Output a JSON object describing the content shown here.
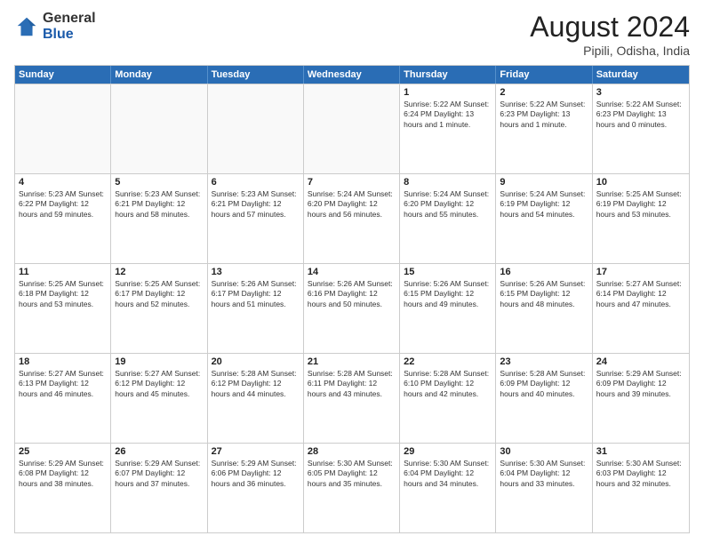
{
  "logo": {
    "general": "General",
    "blue": "Blue"
  },
  "title": "August 2024",
  "location": "Pipili, Odisha, India",
  "days_of_week": [
    "Sunday",
    "Monday",
    "Tuesday",
    "Wednesday",
    "Thursday",
    "Friday",
    "Saturday"
  ],
  "weeks": [
    [
      {
        "day": "",
        "info": "",
        "empty": true
      },
      {
        "day": "",
        "info": "",
        "empty": true
      },
      {
        "day": "",
        "info": "",
        "empty": true
      },
      {
        "day": "",
        "info": "",
        "empty": true
      },
      {
        "day": "1",
        "info": "Sunrise: 5:22 AM\nSunset: 6:24 PM\nDaylight: 13 hours\nand 1 minute.",
        "empty": false
      },
      {
        "day": "2",
        "info": "Sunrise: 5:22 AM\nSunset: 6:23 PM\nDaylight: 13 hours\nand 1 minute.",
        "empty": false
      },
      {
        "day": "3",
        "info": "Sunrise: 5:22 AM\nSunset: 6:23 PM\nDaylight: 13 hours\nand 0 minutes.",
        "empty": false
      }
    ],
    [
      {
        "day": "4",
        "info": "Sunrise: 5:23 AM\nSunset: 6:22 PM\nDaylight: 12 hours\nand 59 minutes.",
        "empty": false
      },
      {
        "day": "5",
        "info": "Sunrise: 5:23 AM\nSunset: 6:21 PM\nDaylight: 12 hours\nand 58 minutes.",
        "empty": false
      },
      {
        "day": "6",
        "info": "Sunrise: 5:23 AM\nSunset: 6:21 PM\nDaylight: 12 hours\nand 57 minutes.",
        "empty": false
      },
      {
        "day": "7",
        "info": "Sunrise: 5:24 AM\nSunset: 6:20 PM\nDaylight: 12 hours\nand 56 minutes.",
        "empty": false
      },
      {
        "day": "8",
        "info": "Sunrise: 5:24 AM\nSunset: 6:20 PM\nDaylight: 12 hours\nand 55 minutes.",
        "empty": false
      },
      {
        "day": "9",
        "info": "Sunrise: 5:24 AM\nSunset: 6:19 PM\nDaylight: 12 hours\nand 54 minutes.",
        "empty": false
      },
      {
        "day": "10",
        "info": "Sunrise: 5:25 AM\nSunset: 6:19 PM\nDaylight: 12 hours\nand 53 minutes.",
        "empty": false
      }
    ],
    [
      {
        "day": "11",
        "info": "Sunrise: 5:25 AM\nSunset: 6:18 PM\nDaylight: 12 hours\nand 53 minutes.",
        "empty": false
      },
      {
        "day": "12",
        "info": "Sunrise: 5:25 AM\nSunset: 6:17 PM\nDaylight: 12 hours\nand 52 minutes.",
        "empty": false
      },
      {
        "day": "13",
        "info": "Sunrise: 5:26 AM\nSunset: 6:17 PM\nDaylight: 12 hours\nand 51 minutes.",
        "empty": false
      },
      {
        "day": "14",
        "info": "Sunrise: 5:26 AM\nSunset: 6:16 PM\nDaylight: 12 hours\nand 50 minutes.",
        "empty": false
      },
      {
        "day": "15",
        "info": "Sunrise: 5:26 AM\nSunset: 6:15 PM\nDaylight: 12 hours\nand 49 minutes.",
        "empty": false
      },
      {
        "day": "16",
        "info": "Sunrise: 5:26 AM\nSunset: 6:15 PM\nDaylight: 12 hours\nand 48 minutes.",
        "empty": false
      },
      {
        "day": "17",
        "info": "Sunrise: 5:27 AM\nSunset: 6:14 PM\nDaylight: 12 hours\nand 47 minutes.",
        "empty": false
      }
    ],
    [
      {
        "day": "18",
        "info": "Sunrise: 5:27 AM\nSunset: 6:13 PM\nDaylight: 12 hours\nand 46 minutes.",
        "empty": false
      },
      {
        "day": "19",
        "info": "Sunrise: 5:27 AM\nSunset: 6:12 PM\nDaylight: 12 hours\nand 45 minutes.",
        "empty": false
      },
      {
        "day": "20",
        "info": "Sunrise: 5:28 AM\nSunset: 6:12 PM\nDaylight: 12 hours\nand 44 minutes.",
        "empty": false
      },
      {
        "day": "21",
        "info": "Sunrise: 5:28 AM\nSunset: 6:11 PM\nDaylight: 12 hours\nand 43 minutes.",
        "empty": false
      },
      {
        "day": "22",
        "info": "Sunrise: 5:28 AM\nSunset: 6:10 PM\nDaylight: 12 hours\nand 42 minutes.",
        "empty": false
      },
      {
        "day": "23",
        "info": "Sunrise: 5:28 AM\nSunset: 6:09 PM\nDaylight: 12 hours\nand 40 minutes.",
        "empty": false
      },
      {
        "day": "24",
        "info": "Sunrise: 5:29 AM\nSunset: 6:09 PM\nDaylight: 12 hours\nand 39 minutes.",
        "empty": false
      }
    ],
    [
      {
        "day": "25",
        "info": "Sunrise: 5:29 AM\nSunset: 6:08 PM\nDaylight: 12 hours\nand 38 minutes.",
        "empty": false
      },
      {
        "day": "26",
        "info": "Sunrise: 5:29 AM\nSunset: 6:07 PM\nDaylight: 12 hours\nand 37 minutes.",
        "empty": false
      },
      {
        "day": "27",
        "info": "Sunrise: 5:29 AM\nSunset: 6:06 PM\nDaylight: 12 hours\nand 36 minutes.",
        "empty": false
      },
      {
        "day": "28",
        "info": "Sunrise: 5:30 AM\nSunset: 6:05 PM\nDaylight: 12 hours\nand 35 minutes.",
        "empty": false
      },
      {
        "day": "29",
        "info": "Sunrise: 5:30 AM\nSunset: 6:04 PM\nDaylight: 12 hours\nand 34 minutes.",
        "empty": false
      },
      {
        "day": "30",
        "info": "Sunrise: 5:30 AM\nSunset: 6:04 PM\nDaylight: 12 hours\nand 33 minutes.",
        "empty": false
      },
      {
        "day": "31",
        "info": "Sunrise: 5:30 AM\nSunset: 6:03 PM\nDaylight: 12 hours\nand 32 minutes.",
        "empty": false
      }
    ]
  ]
}
